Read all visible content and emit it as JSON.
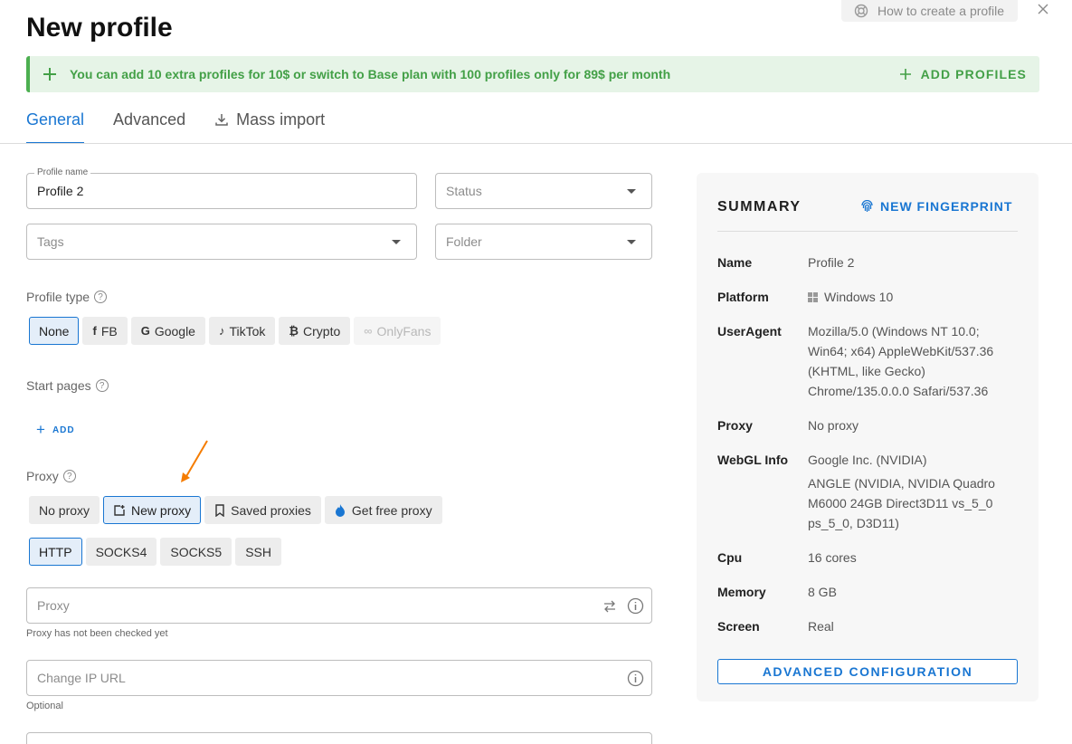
{
  "help": {
    "label": "How to create a profile"
  },
  "title": "New profile",
  "banner": {
    "text": "You can add 10 extra profiles for 10$ or switch to Base plan with 100 profiles only for 89$ per month",
    "action": "ADD PROFILES",
    "color": "#43a047"
  },
  "tabs": [
    {
      "label": "General",
      "active": true
    },
    {
      "label": "Advanced",
      "active": false
    },
    {
      "label": "Mass import",
      "active": false
    }
  ],
  "form": {
    "profile_name": {
      "label": "Profile name",
      "value": "Profile 2"
    },
    "status": {
      "placeholder": "Status"
    },
    "tags": {
      "placeholder": "Tags"
    },
    "folder": {
      "placeholder": "Folder"
    },
    "profile_type": {
      "label": "Profile type",
      "options": [
        "None",
        "FB",
        "Google",
        "TikTok",
        "Crypto",
        "OnlyFans"
      ],
      "selected": "None"
    },
    "start_pages": {
      "label": "Start pages",
      "add": "ADD"
    },
    "proxy": {
      "label": "Proxy",
      "modes": [
        "No proxy",
        "New proxy",
        "Saved proxies",
        "Get free proxy"
      ],
      "selected_mode": "New proxy",
      "protocols": [
        "HTTP",
        "SOCKS4",
        "SOCKS5",
        "SSH"
      ],
      "selected_protocol": "HTTP",
      "input_placeholder": "Proxy",
      "hint": "Proxy has not been checked yet",
      "change_ip_placeholder": "Change IP URL",
      "change_ip_hint": "Optional"
    }
  },
  "summary": {
    "title": "SUMMARY",
    "new_fingerprint": "NEW FINGERPRINT",
    "rows": {
      "name": {
        "key": "Name",
        "value": "Profile 2"
      },
      "platform": {
        "key": "Platform",
        "value": "Windows 10"
      },
      "useragent": {
        "key": "UserAgent",
        "value": "Mozilla/5.0 (Windows NT 10.0; Win64; x64) AppleWebKit/537.36 (KHTML, like Gecko) Chrome/135.0.0.0 Safari/537.36"
      },
      "proxy": {
        "key": "Proxy",
        "value": "No proxy"
      },
      "webgl": {
        "key": "WebGL Info",
        "vendor": "Google Inc. (NVIDIA)",
        "renderer": "ANGLE (NVIDIA, NVIDIA Quadro M6000 24GB Direct3D11 vs_5_0 ps_5_0, D3D11)"
      },
      "cpu": {
        "key": "Cpu",
        "value": "16 cores"
      },
      "memory": {
        "key": "Memory",
        "value": "8 GB"
      },
      "screen": {
        "key": "Screen",
        "value": "Real"
      }
    },
    "advanced_button": "ADVANCED CONFIGURATION"
  },
  "colors": {
    "accent": "#1976d2",
    "success": "#43a047",
    "arrow": "#f57c00"
  }
}
